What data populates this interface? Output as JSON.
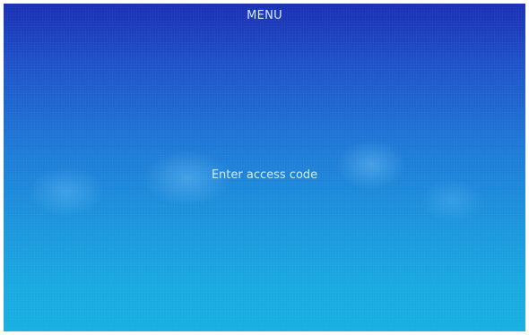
{
  "header": {
    "title": "MENU"
  },
  "main": {
    "prompt": "Enter access code"
  }
}
